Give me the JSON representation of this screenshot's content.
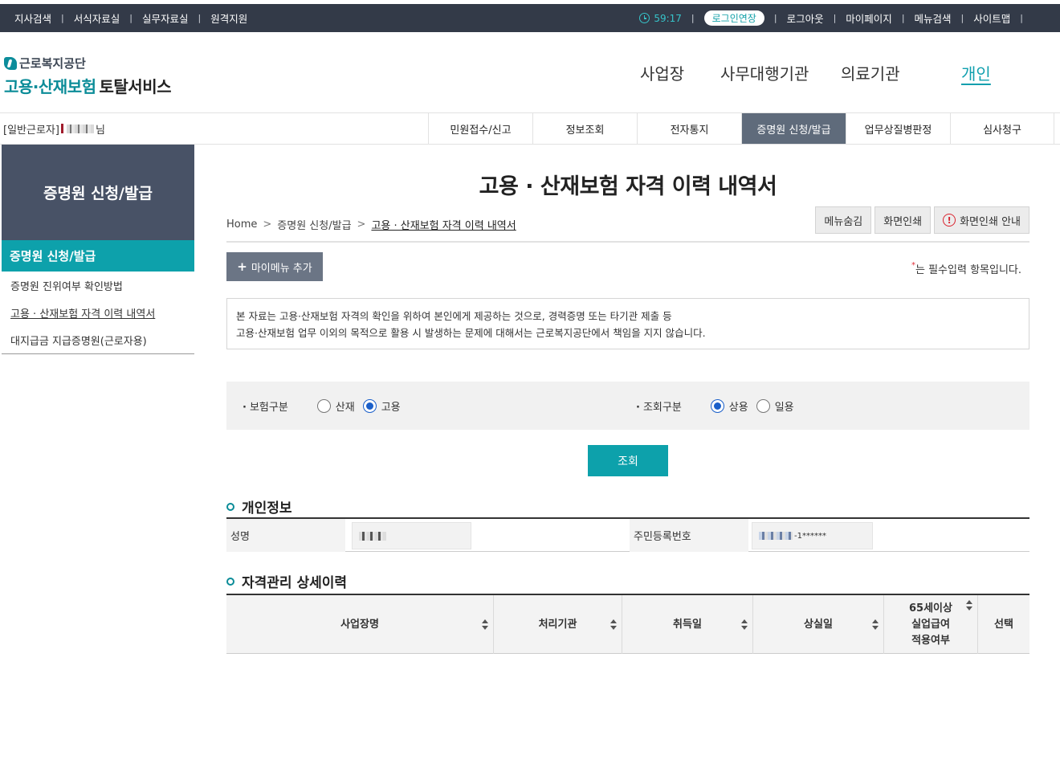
{
  "topbar": {
    "left_links": [
      "지사검색",
      "서식자료실",
      "실무자료실",
      "원격지원"
    ],
    "timer": "59:17",
    "login_extend": "로그인연장",
    "right_links": [
      "로그아웃",
      "마이페이지",
      "메뉴검색",
      "사이트맵"
    ],
    "separator": "|"
  },
  "logo": {
    "org": "근로복지공단",
    "service_teal": "고용·산재보험",
    "service_dark": "토탈서비스"
  },
  "gnb": [
    "사업장",
    "사무대행기관",
    "의료기관",
    "개인"
  ],
  "user": {
    "prefix": "[일반근로자]",
    "suffix": "님"
  },
  "subtabs": [
    "민원접수/신고",
    "정보조회",
    "전자통지",
    "증명원 신청/발급",
    "업무상질병판정",
    "심사청구"
  ],
  "sidebar": {
    "heading": "증명원 신청/발급",
    "active": "증명원 신청/발급",
    "items": [
      "증명원 진위여부 확인방법",
      "고용 · 산재보험 자격 이력 내역서",
      "대지급금 지급증명원(근로자용)"
    ]
  },
  "page": {
    "title": "고용 · 산재보험 자격 이력 내역서",
    "breadcrumb": [
      "Home",
      "증명원 신청/발급",
      "고용 · 산재보험 자격 이력 내역서"
    ],
    "util_buttons": [
      "메뉴숨김",
      "화면인쇄",
      "화면인쇄 안내"
    ],
    "alert_symbol": "!",
    "mymenu_plus": "+",
    "mymenu_label": "마이메뉴 추가",
    "required_star": "*",
    "required_text": "는 필수입력 항목입니다.",
    "notice_line1": "본 자료는 고용·산재보험 자격의 확인을 위하여 본인에게 제공하는 것으로, 경력증명 또는 타기관 제출 등",
    "notice_line2": "고용·산재보험 업무 이외의 목적으로 활용 시 발생하는 문제에 대해서는 근로복지공단에서 책임을 지지 않습니다."
  },
  "search": {
    "insurance_label": "보험구분",
    "insurance_options": [
      "산재",
      "고용"
    ],
    "insurance_selected": "고용",
    "query_label": "조회구분",
    "query_options": [
      "상용",
      "일용"
    ],
    "query_selected": "상용",
    "button": "조회"
  },
  "personal": {
    "title": "개인정보",
    "name_label": "성명",
    "rrn_label": "주민등록번호",
    "rrn_suffix": "-1******"
  },
  "history": {
    "title": "자격관리 상세이력",
    "columns": [
      "사업장명",
      "처리기관",
      "취득일",
      "상실일",
      "65세이상\n실업급여\n적용여부",
      "선택"
    ]
  },
  "colors": {
    "topbar": "#333a48",
    "accent_teal": "#0da1ab",
    "active_tab": "#5f6b7b",
    "sidebar_head": "#485266"
  }
}
